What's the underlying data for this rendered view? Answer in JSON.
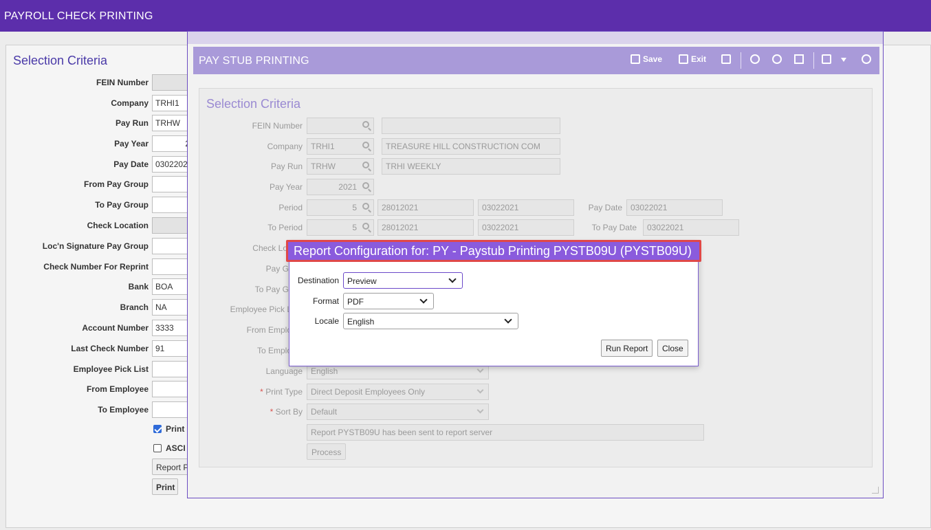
{
  "app": {
    "title": "PAYROLL CHECK PRINTING"
  },
  "background": {
    "section_title": "Selection Criteria",
    "fields": [
      {
        "label": "FEIN Number",
        "value": ""
      },
      {
        "label": "Company",
        "value": "TRHI1"
      },
      {
        "label": "Pay Run",
        "value": "TRHW"
      },
      {
        "label": "Pay Year",
        "value": "2"
      },
      {
        "label": "Pay Date",
        "value": "0302202"
      },
      {
        "label": "From Pay Group",
        "value": ""
      },
      {
        "label": "To Pay Group",
        "value": ""
      },
      {
        "label": "Check Location",
        "value": ""
      },
      {
        "label": "Loc'n Signature Pay Group",
        "value": ""
      },
      {
        "label": "Check Number For Reprint",
        "value": ""
      },
      {
        "label": "Bank",
        "value": "BOA"
      },
      {
        "label": "Branch",
        "value": "NA"
      },
      {
        "label": "Account Number",
        "value": "3333"
      },
      {
        "label": "Last Check Number",
        "value": "91"
      },
      {
        "label": "Employee Pick List",
        "value": ""
      },
      {
        "label": "From Employee",
        "value": ""
      },
      {
        "label": "To Employee",
        "value": ""
      }
    ],
    "checkbox_print_label": "Print",
    "checkbox_ascii_label": "ASCI",
    "report_button_label": "Report P",
    "print_button_label": "Print"
  },
  "paystub": {
    "title": "PAY STUB PRINTING",
    "toolbar": {
      "save": "Save",
      "exit": "Exit"
    },
    "section_title": "Selection Criteria",
    "fein_label": "FEIN Number",
    "fein_value": "",
    "fein_desc": "",
    "company_label": "Company",
    "company_value": "TRHI1",
    "company_desc": "TREASURE HILL CONSTRUCTION COM",
    "payrun_label": "Pay Run",
    "payrun_value": "TRHW",
    "payrun_desc": "TRHI WEEKLY",
    "payyear_label": "Pay Year",
    "payyear_value": "2021",
    "period_label": "Period",
    "period_value": "5",
    "period_start": "28012021",
    "period_end": "03022021",
    "paydate_label": "Pay Date",
    "paydate_value": "03022021",
    "toperiod_label": "To Period",
    "toperiod_value": "5",
    "toperiod_start": "28012021",
    "toperiod_end": "03022021",
    "topaydate_label": "To Pay Date",
    "topaydate_value": "03022021",
    "checkloc_label": "Check Loc",
    "paygroup_label": "Pay Gr",
    "topaygroup_label": "To Pay Gr",
    "emppick_label": "Employee Pick L",
    "fromemp_label": "From Emplo",
    "toemp_label": "To Emplo",
    "language_label": "Language",
    "language_value": "English",
    "printtype_label": "Print Type",
    "printtype_value": "Direct Deposit Employees Only",
    "sortby_label": "Sort By",
    "sortby_value": "Default",
    "req_mark": "*",
    "status_message": "Report PYSTB09U has been sent to report server",
    "process_label": "Process"
  },
  "dialog": {
    "title": "Report Configuration for: PY - Paystub Printing PYSTB09U (PYSTB09U)",
    "destination_label": "Destination",
    "destination_value": "Preview",
    "format_label": "Format",
    "format_value": "PDF",
    "locale_label": "Locale",
    "locale_value": "English",
    "run_report_label": "Run Report",
    "close_label": "Close"
  },
  "colors": {
    "brand": "#5c2eab",
    "header_light": "#a99ad9",
    "dialog_header": "#8a5bdd",
    "highlight_border": "#e04848"
  }
}
